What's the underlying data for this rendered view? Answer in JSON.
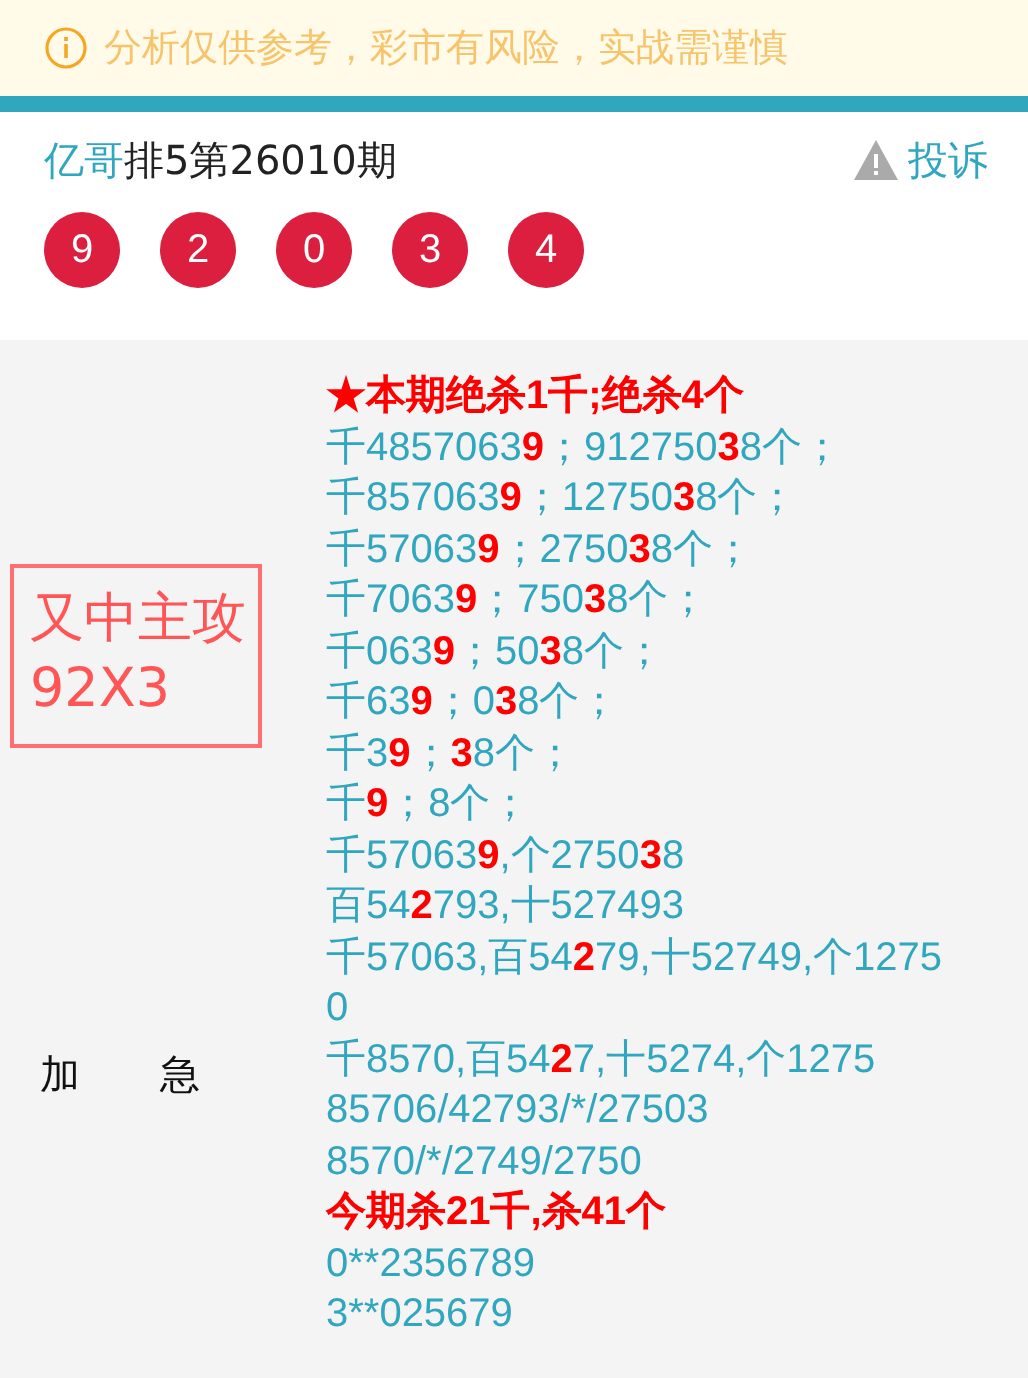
{
  "notice": {
    "text": "分析仅供参考，彩市有风险，实战需谨慎"
  },
  "header": {
    "author": "亿哥",
    "title": "排5第26010期",
    "complaint": "投诉"
  },
  "balls": [
    "9",
    "2",
    "0",
    "3",
    "4"
  ],
  "side": {
    "badge": [
      "又中主攻",
      "92X3"
    ],
    "tag": "加　　急"
  },
  "lines": [
    {
      "kind": "headline",
      "text": "★本期绝杀1千;绝杀4个"
    },
    {
      "kind": "normal",
      "text": "千4857063**9**；912750**3**8个；"
    },
    {
      "kind": "normal",
      "text": "千857063**9**；12750**3**8个；"
    },
    {
      "kind": "normal",
      "text": "千57063**9**；2750**3**8个；"
    },
    {
      "kind": "normal",
      "text": "千7063**9**；750**3**8个；"
    },
    {
      "kind": "normal",
      "text": "千063**9**；50**3**8个；"
    },
    {
      "kind": "normal",
      "text": "千63**9**；0**3**8个；"
    },
    {
      "kind": "normal",
      "text": "千3**9**；**3**8个；"
    },
    {
      "kind": "normal",
      "text": "千**9**；8个；"
    },
    {
      "kind": "normal",
      "text": "千57063**9**,个2750**3**8"
    },
    {
      "kind": "normal",
      "text": "百54**2**793,十527493"
    },
    {
      "kind": "normal",
      "text": "千57063,百54**2**79,十52749,个12750"
    },
    {
      "kind": "normal",
      "text": "千8570,百54**2**7,十5274,个1275"
    },
    {
      "kind": "normal",
      "text": "85706/42793/*/27503"
    },
    {
      "kind": "normal",
      "text": "8570/*/2749/2750"
    },
    {
      "kind": "headline",
      "text": "今期杀21千,杀41个"
    },
    {
      "kind": "normal",
      "text": "0**2356789"
    },
    {
      "kind": "normal",
      "text": "3**025679"
    }
  ]
}
